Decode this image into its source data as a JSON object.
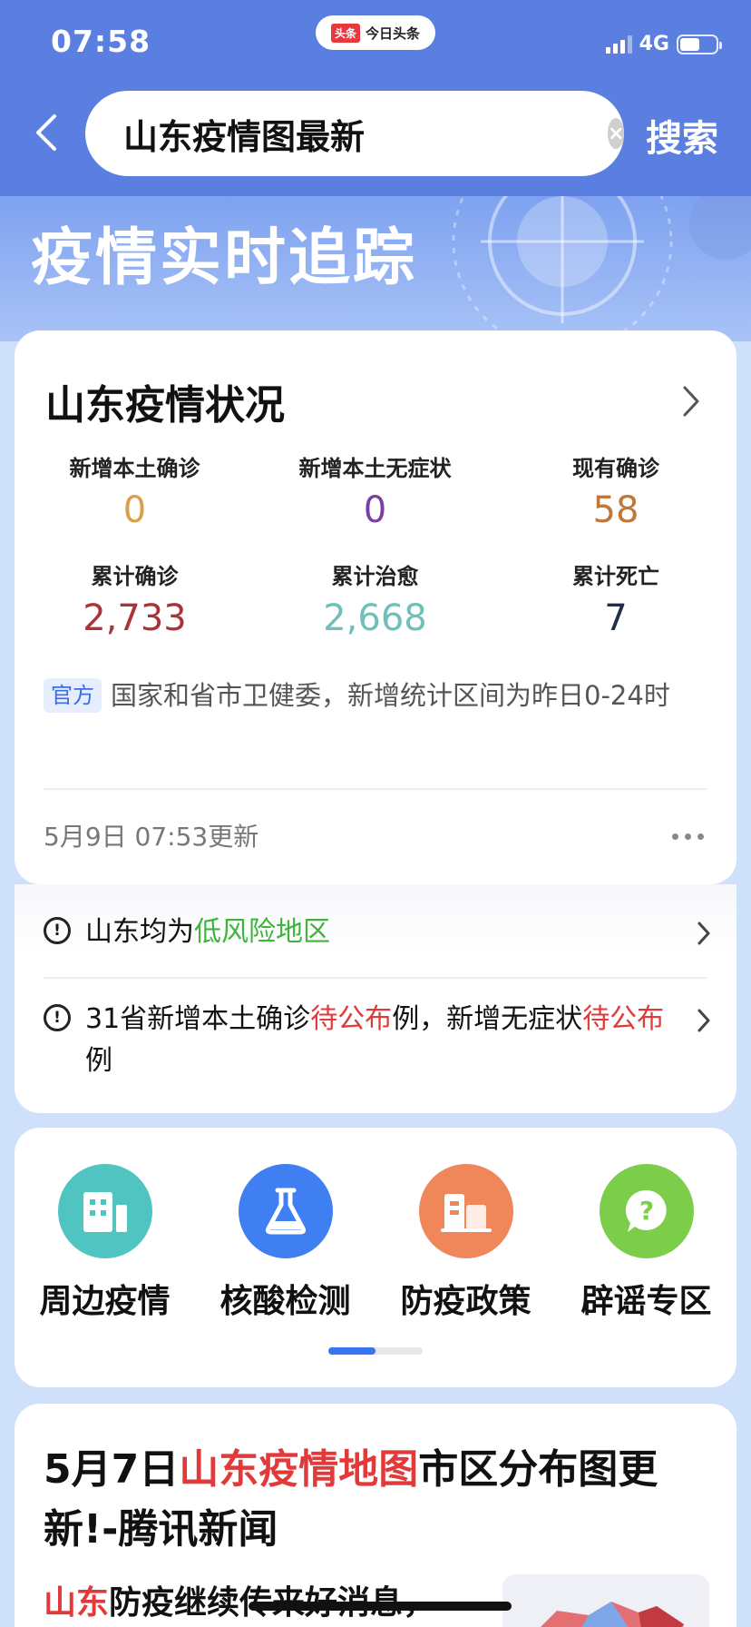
{
  "status_bar": {
    "time": "07:58",
    "app_logo": "头条",
    "app_name": "今日头条",
    "network": "4G",
    "battery_level": 0.55
  },
  "search": {
    "query": "山东疫情图最新",
    "button_label": "搜索"
  },
  "banner": {
    "title": "疫情实时追踪"
  },
  "status_card": {
    "title": "山东疫情状况",
    "stats": [
      {
        "label": "新增本土确诊",
        "value": "0",
        "color": "#d9a045"
      },
      {
        "label": "新增本土无症状",
        "value": "0",
        "color": "#7a3fa0"
      },
      {
        "label": "现有确诊",
        "value": "58",
        "color": "#c0773a"
      },
      {
        "label": "累计确诊",
        "value": "2,733",
        "color": "#a8343a"
      },
      {
        "label": "累计治愈",
        "value": "2,668",
        "color": "#6fc0b8"
      },
      {
        "label": "累计死亡",
        "value": "7",
        "color": "#1e2f4a"
      }
    ],
    "source_tag": "官方",
    "source_text": "国家和省市卫健委，新增统计区间为昨日0-24时",
    "update_time": "5月9日 07:53更新"
  },
  "risk_card": {
    "row1_prefix": "山东均为",
    "row1_highlight": "低风险地区",
    "row2_part1": "31省新增本土确诊",
    "row2_highlight1": "待公布",
    "row2_part2": "例，新增无症状",
    "row2_highlight2": "待公布",
    "row2_part3": "例"
  },
  "shortcuts": [
    {
      "label": "周边疫情",
      "icon": "building-icon",
      "color": "#4fc4c0"
    },
    {
      "label": "核酸检测",
      "icon": "flask-icon",
      "color": "#3f7ff2"
    },
    {
      "label": "防疫政策",
      "icon": "document-building-icon",
      "color": "#f0875a"
    },
    {
      "label": "辟谣专区",
      "icon": "question-chat-icon",
      "color": "#7ccd4a"
    }
  ],
  "news": {
    "title_part1": "5月7日",
    "title_highlight": "山东疫情地图",
    "title_part2": "市区分布图更新!-腾讯新闻",
    "snippet_highlight": "山东",
    "snippet_text": "防疫继续传来好消息，"
  }
}
